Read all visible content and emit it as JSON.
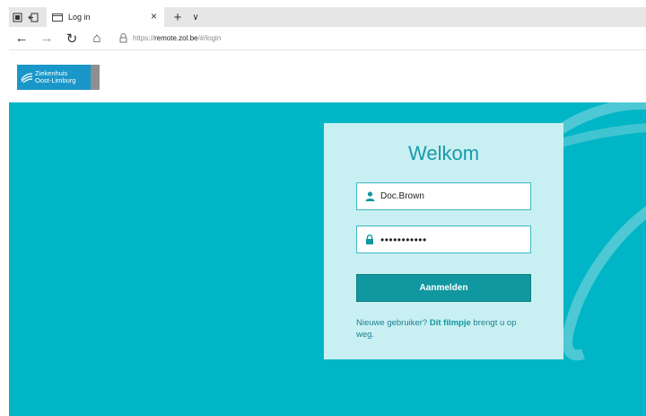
{
  "browser": {
    "tab": {
      "title": "Log in",
      "close": "×"
    },
    "new_tab": "+",
    "tab_list": "∨",
    "nav": {
      "back": "←",
      "forward": "→",
      "refresh": "↻",
      "home": "⌂"
    },
    "url": {
      "protocol": "https://",
      "host": "remote.zol.be",
      "path": "/#/login"
    }
  },
  "header": {
    "logo_line1": "Ziekenhuis",
    "logo_line2": "Oost-Limburg"
  },
  "login": {
    "title": "Welkom",
    "username_value": "Doc.Brown",
    "password_value": "•••••••••••",
    "submit_label": "Aanmelden",
    "help_prefix": "Nieuwe gebruiker? ",
    "help_link": "Dit filmpje",
    "help_suffix": " brengt u op weg."
  },
  "colors": {
    "hero_bg": "#00b6c6",
    "card_bg": "#c8f0f3",
    "accent": "#11979f",
    "logo_blue": "#1a97c9"
  },
  "icons": [
    "tab-actions-icon",
    "tab-back-icon",
    "page-icon",
    "close-icon",
    "plus-icon",
    "chevron-down-icon",
    "back-arrow-icon",
    "forward-arrow-icon",
    "refresh-icon",
    "home-icon",
    "lock-icon",
    "user-icon",
    "padlock-icon"
  ]
}
